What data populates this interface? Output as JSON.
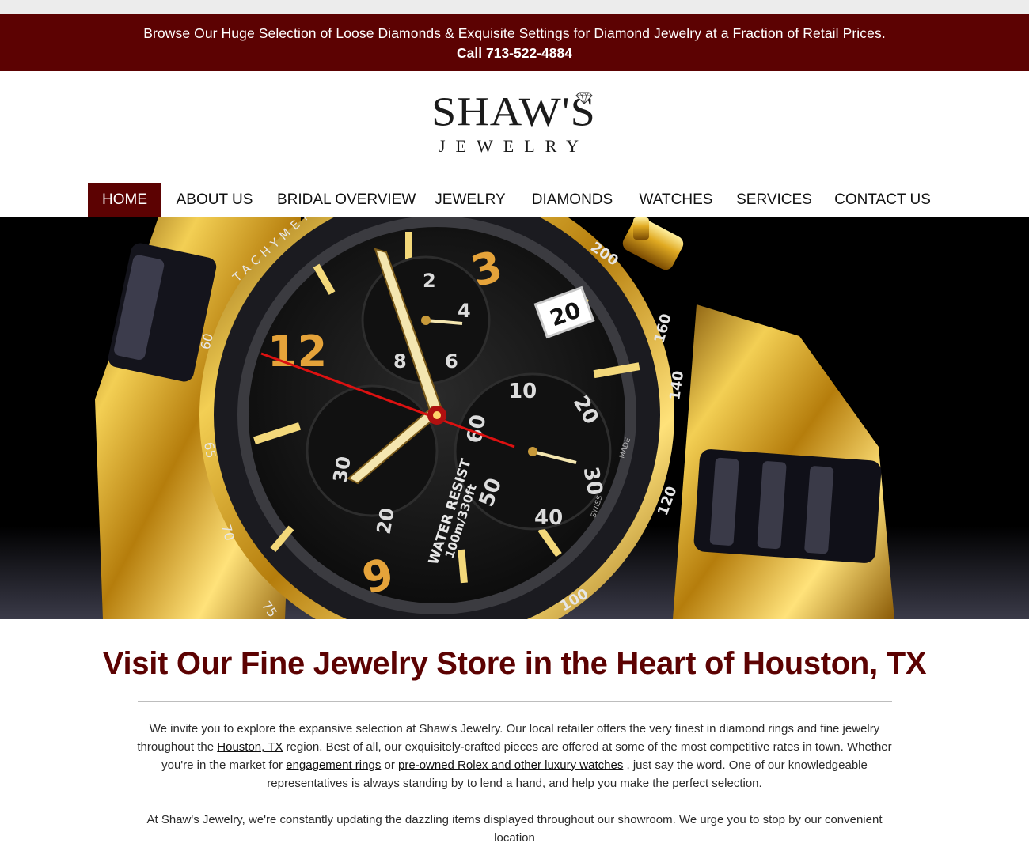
{
  "promo": {
    "line": "Browse Our Huge Selection of Loose Diamonds & Exquisite Settings for Diamond Jewelry at a Fraction of Retail Prices.",
    "phone": "Call 713-522-4884"
  },
  "logo": {
    "name": "SHAW'S",
    "subtitle": "JEWELRY",
    "icon": "diamond-icon"
  },
  "nav": {
    "items": [
      {
        "label": "HOME",
        "active": true
      },
      {
        "label": "ABOUT US"
      },
      {
        "label": "BRIDAL OVERVIEW"
      },
      {
        "label": "JEWELRY"
      },
      {
        "label": "DIAMONDS"
      },
      {
        "label": "WATCHES"
      },
      {
        "label": "SERVICES"
      },
      {
        "label": "CONTACT US"
      }
    ]
  },
  "hero": {
    "watch": {
      "bezel_text": "TACHYMETER",
      "bezel_numbers": [
        "200",
        "160",
        "140",
        "120",
        "100",
        "75",
        "70",
        "65",
        "60"
      ],
      "dial_numerals": [
        "12",
        "3",
        "9"
      ],
      "date": "20",
      "sub_dial_top": [
        "2",
        "4",
        "6",
        "8"
      ],
      "sub_dial_right": [
        "10",
        "20",
        "30",
        "40",
        "50",
        "60"
      ],
      "sub_dial_left": [
        "30",
        "20"
      ],
      "water_resist": "WATER RESIST",
      "depth": "100m/330ft",
      "swiss": "SWISS",
      "made": "MADE"
    }
  },
  "content": {
    "headline": "Visit Our Fine Jewelry Store in the Heart of Houston, TX",
    "p1": {
      "t1": "We invite you to explore the expansive selection at Shaw's Jewelry. Our local retailer offers the very finest in diamond rings and fine jewelry throughout the ",
      "link1": "Houston, TX",
      "t2": " region. Best of all, our exquisitely-crafted pieces are offered at some of the most competitive rates in town. Whether you're in the market for ",
      "link2": "engagement rings",
      "t3": " or ",
      "link3": "pre-owned Rolex and other luxury watches",
      "t4": " , just say the word. One of our knowledgeable representatives is always standing by to lend a hand, and help you make the perfect selection."
    },
    "p2": "At Shaw's Jewelry, we're constantly updating the dazzling items displayed throughout our showroom. We urge you to stop by our convenient location"
  },
  "colors": {
    "brand": "#5c0202",
    "gold": "#d4a017"
  }
}
